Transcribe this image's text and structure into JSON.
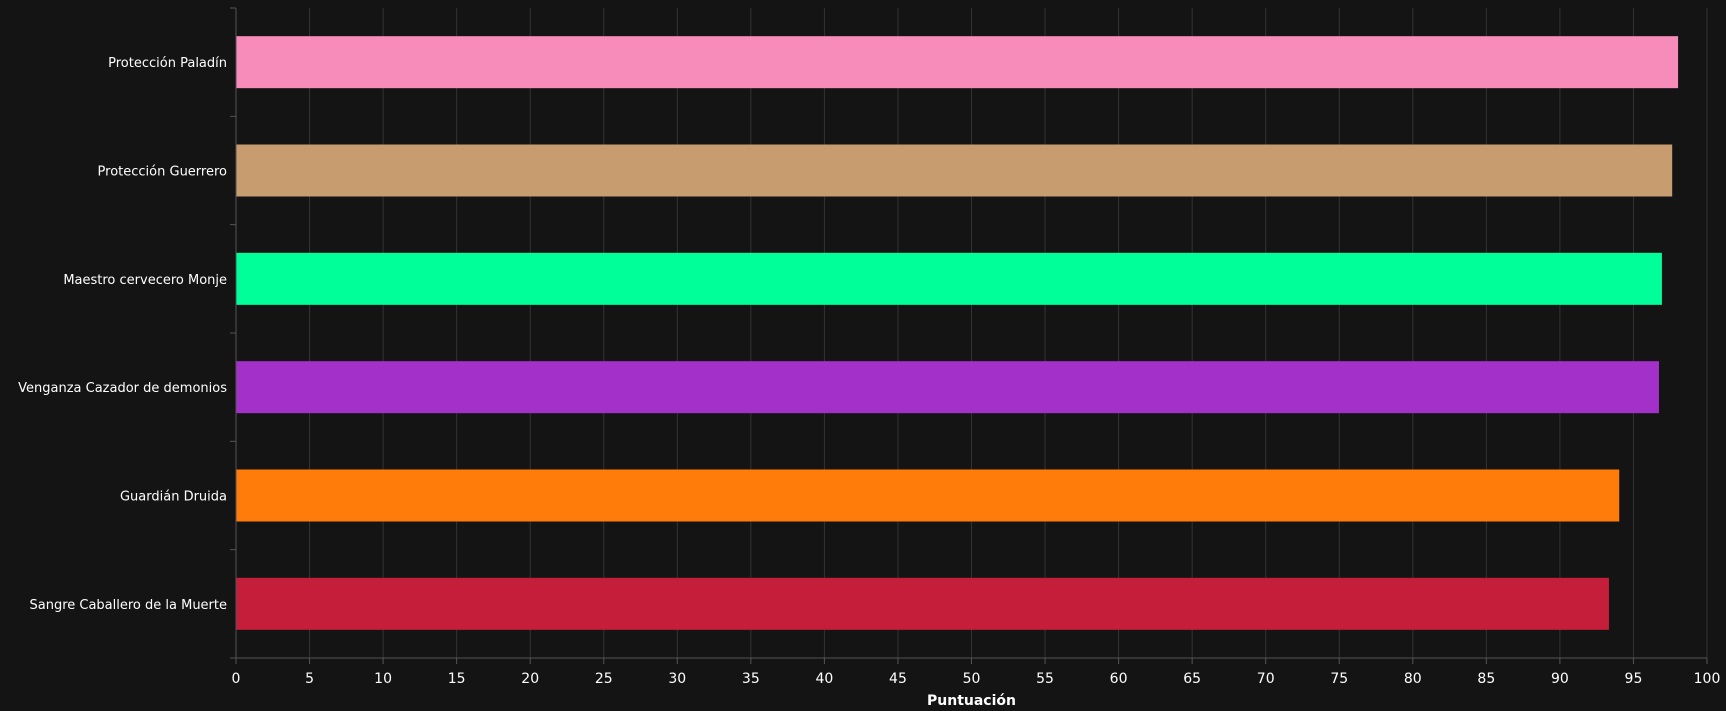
{
  "chart_data": {
    "type": "bar",
    "orientation": "horizontal",
    "categories": [
      "Protección Paladín",
      "Protección Guerrero",
      "Maestro cervecero Monje",
      "Venganza Cazador de demonios",
      "Guardián Druida",
      "Sangre Caballero de la Muerte"
    ],
    "values": [
      98.0,
      97.6,
      96.9,
      96.7,
      94.0,
      93.3
    ],
    "colors": [
      "#f78cba",
      "#c79c6e",
      "#00ff98",
      "#a330c9",
      "#ff7c0a",
      "#c41e3a"
    ],
    "xlabel": "Puntuación",
    "ylabel": "",
    "title": "",
    "xlim": [
      0,
      100
    ],
    "xticks": [
      "0",
      "5",
      "10",
      "15",
      "20",
      "25",
      "30",
      "35",
      "40",
      "45",
      "50",
      "55",
      "60",
      "65",
      "70",
      "75",
      "80",
      "85",
      "90",
      "95",
      "100"
    ],
    "grid": true,
    "background": "#141414",
    "grid_color": "#333333",
    "axis_color": "#555555"
  }
}
